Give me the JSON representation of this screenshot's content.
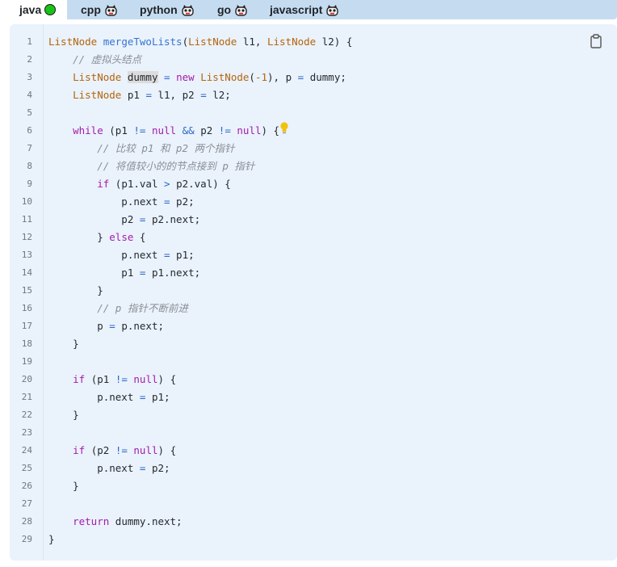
{
  "tabs": [
    {
      "label": "java",
      "active": true,
      "icon": "green-dot-icon"
    },
    {
      "label": "cpp",
      "active": false,
      "icon": "robot-icon"
    },
    {
      "label": "python",
      "active": false,
      "icon": "robot-icon"
    },
    {
      "label": "go",
      "active": false,
      "icon": "robot-icon"
    },
    {
      "label": "javascript",
      "active": false,
      "icon": "robot-icon"
    }
  ],
  "copy_icon": "clipboard-icon",
  "hint_icon": "lightbulb-icon",
  "colors": {
    "tab_bar": "#c5dcf0",
    "code_bg": "#eaf2fb",
    "type": "#b5650d",
    "function": "#3574d4",
    "keyword": "#a31dab",
    "operator": "#2a68c8",
    "comment": "#8b8f96",
    "status_dot": "#18c318"
  },
  "code": {
    "line_numbers": [
      "1",
      "2",
      "3",
      "4",
      "5",
      "6",
      "7",
      "8",
      "9",
      "10",
      "11",
      "12",
      "13",
      "14",
      "15",
      "16",
      "17",
      "18",
      "19",
      "20",
      "21",
      "22",
      "23",
      "24",
      "25",
      "26",
      "27",
      "28",
      "29"
    ],
    "lines": [
      [
        {
          "t": "type",
          "v": "ListNode"
        },
        {
          "t": "plain",
          "v": " "
        },
        {
          "t": "fn",
          "v": "mergeTwoLists"
        },
        {
          "t": "plain",
          "v": "("
        },
        {
          "t": "type",
          "v": "ListNode"
        },
        {
          "t": "plain",
          "v": " l1, "
        },
        {
          "t": "type",
          "v": "ListNode"
        },
        {
          "t": "plain",
          "v": " l2) {"
        }
      ],
      [
        {
          "t": "plain",
          "v": "    "
        },
        {
          "t": "cm",
          "v": "// 虚拟头结点"
        }
      ],
      [
        {
          "t": "plain",
          "v": "    "
        },
        {
          "t": "type",
          "v": "ListNode"
        },
        {
          "t": "plain",
          "v": " "
        },
        {
          "t": "hl",
          "v": "dummy"
        },
        {
          "t": "plain",
          "v": " "
        },
        {
          "t": "op",
          "v": "="
        },
        {
          "t": "plain",
          "v": " "
        },
        {
          "t": "kw",
          "v": "new"
        },
        {
          "t": "plain",
          "v": " "
        },
        {
          "t": "type",
          "v": "ListNode"
        },
        {
          "t": "plain",
          "v": "("
        },
        {
          "t": "num",
          "v": "-1"
        },
        {
          "t": "plain",
          "v": "), p "
        },
        {
          "t": "op",
          "v": "="
        },
        {
          "t": "plain",
          "v": " dummy;"
        }
      ],
      [
        {
          "t": "plain",
          "v": "    "
        },
        {
          "t": "type",
          "v": "ListNode"
        },
        {
          "t": "plain",
          "v": " p1 "
        },
        {
          "t": "op",
          "v": "="
        },
        {
          "t": "plain",
          "v": " l1, p2 "
        },
        {
          "t": "op",
          "v": "="
        },
        {
          "t": "plain",
          "v": " l2;"
        }
      ],
      [],
      [
        {
          "t": "plain",
          "v": "    "
        },
        {
          "t": "kw",
          "v": "while"
        },
        {
          "t": "plain",
          "v": " (p1 "
        },
        {
          "t": "op",
          "v": "!="
        },
        {
          "t": "plain",
          "v": " "
        },
        {
          "t": "kw",
          "v": "null"
        },
        {
          "t": "plain",
          "v": " "
        },
        {
          "t": "op",
          "v": "&&"
        },
        {
          "t": "plain",
          "v": " p2 "
        },
        {
          "t": "op",
          "v": "!="
        },
        {
          "t": "plain",
          "v": " "
        },
        {
          "t": "kw",
          "v": "null"
        },
        {
          "t": "plain",
          "v": ") {"
        }
      ],
      [
        {
          "t": "plain",
          "v": "        "
        },
        {
          "t": "cm",
          "v": "// 比较 p1 和 p2 两个指针"
        }
      ],
      [
        {
          "t": "plain",
          "v": "        "
        },
        {
          "t": "cm",
          "v": "// 将值较小的的节点接到 p 指针"
        }
      ],
      [
        {
          "t": "plain",
          "v": "        "
        },
        {
          "t": "kw",
          "v": "if"
        },
        {
          "t": "plain",
          "v": " (p1.val "
        },
        {
          "t": "op",
          "v": ">"
        },
        {
          "t": "plain",
          "v": " p2.val) {"
        }
      ],
      [
        {
          "t": "plain",
          "v": "            p.next "
        },
        {
          "t": "op",
          "v": "="
        },
        {
          "t": "plain",
          "v": " p2;"
        }
      ],
      [
        {
          "t": "plain",
          "v": "            p2 "
        },
        {
          "t": "op",
          "v": "="
        },
        {
          "t": "plain",
          "v": " p2.next;"
        }
      ],
      [
        {
          "t": "plain",
          "v": "        } "
        },
        {
          "t": "kw",
          "v": "else"
        },
        {
          "t": "plain",
          "v": " {"
        }
      ],
      [
        {
          "t": "plain",
          "v": "            p.next "
        },
        {
          "t": "op",
          "v": "="
        },
        {
          "t": "plain",
          "v": " p1;"
        }
      ],
      [
        {
          "t": "plain",
          "v": "            p1 "
        },
        {
          "t": "op",
          "v": "="
        },
        {
          "t": "plain",
          "v": " p1.next;"
        }
      ],
      [
        {
          "t": "plain",
          "v": "        }"
        }
      ],
      [
        {
          "t": "plain",
          "v": "        "
        },
        {
          "t": "cm",
          "v": "// p 指针不断前进"
        }
      ],
      [
        {
          "t": "plain",
          "v": "        p "
        },
        {
          "t": "op",
          "v": "="
        },
        {
          "t": "plain",
          "v": " p.next;"
        }
      ],
      [
        {
          "t": "plain",
          "v": "    }"
        }
      ],
      [],
      [
        {
          "t": "plain",
          "v": "    "
        },
        {
          "t": "kw",
          "v": "if"
        },
        {
          "t": "plain",
          "v": " (p1 "
        },
        {
          "t": "op",
          "v": "!="
        },
        {
          "t": "plain",
          "v": " "
        },
        {
          "t": "kw",
          "v": "null"
        },
        {
          "t": "plain",
          "v": ") {"
        }
      ],
      [
        {
          "t": "plain",
          "v": "        p.next "
        },
        {
          "t": "op",
          "v": "="
        },
        {
          "t": "plain",
          "v": " p1;"
        }
      ],
      [
        {
          "t": "plain",
          "v": "    }"
        }
      ],
      [],
      [
        {
          "t": "plain",
          "v": "    "
        },
        {
          "t": "kw",
          "v": "if"
        },
        {
          "t": "plain",
          "v": " (p2 "
        },
        {
          "t": "op",
          "v": "!="
        },
        {
          "t": "plain",
          "v": " "
        },
        {
          "t": "kw",
          "v": "null"
        },
        {
          "t": "plain",
          "v": ") {"
        }
      ],
      [
        {
          "t": "plain",
          "v": "        p.next "
        },
        {
          "t": "op",
          "v": "="
        },
        {
          "t": "plain",
          "v": " p2;"
        }
      ],
      [
        {
          "t": "plain",
          "v": "    }"
        }
      ],
      [],
      [
        {
          "t": "plain",
          "v": "    "
        },
        {
          "t": "kw",
          "v": "return"
        },
        {
          "t": "plain",
          "v": " dummy.next;"
        }
      ],
      [
        {
          "t": "plain",
          "v": "}"
        }
      ]
    ]
  }
}
